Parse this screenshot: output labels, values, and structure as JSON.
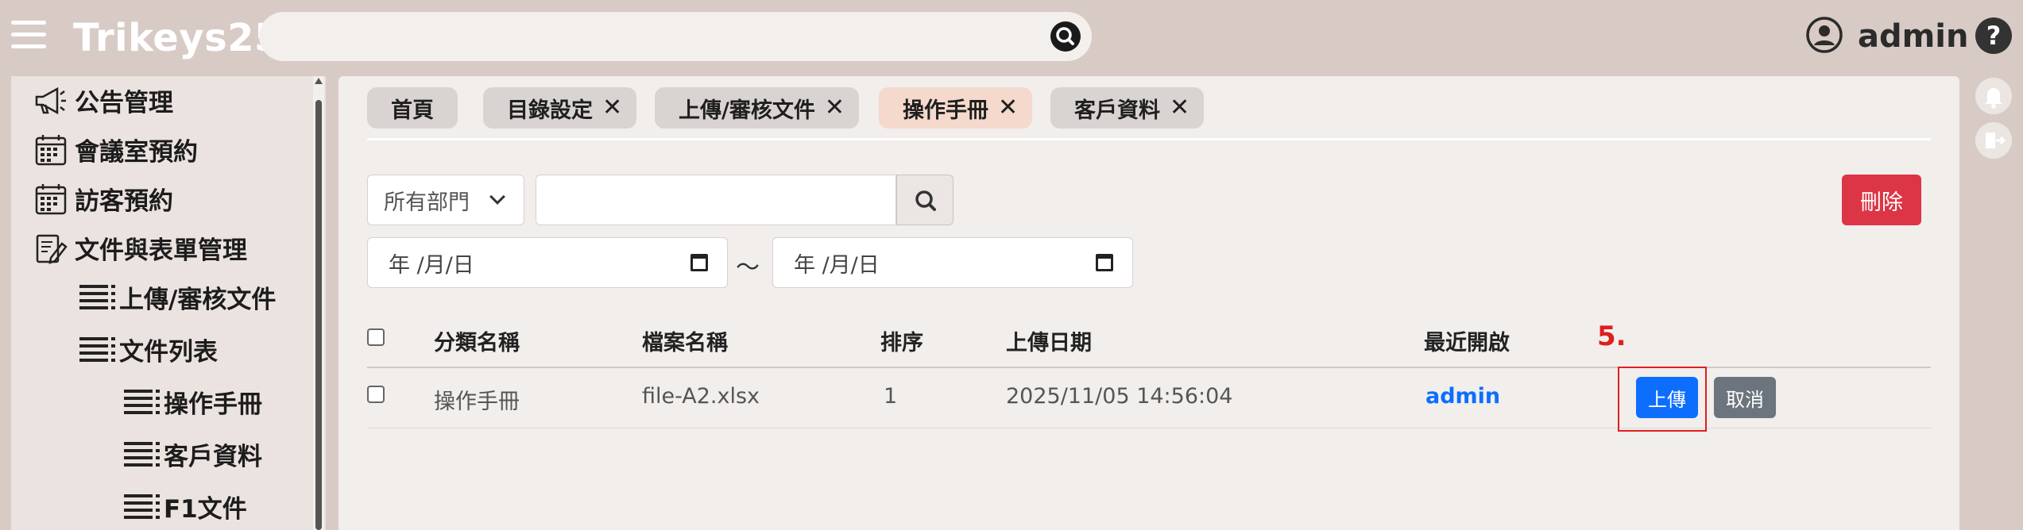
{
  "header": {
    "brand": "Trikeys25",
    "search_placeholder": "",
    "user_name": "admin",
    "help_glyph": "?"
  },
  "sidebar": {
    "items": [
      {
        "label": "公告管理",
        "icon": "megaphone-icon"
      },
      {
        "label": "會議室預約",
        "icon": "calendar-icon"
      },
      {
        "label": "訪客預約",
        "icon": "calendar-icon"
      },
      {
        "label": "文件與表單管理",
        "icon": "document-edit-icon"
      },
      {
        "label": "上傳/審核文件",
        "icon": "list-icon"
      },
      {
        "label": "文件列表",
        "icon": "list-icon"
      },
      {
        "label": "操作手冊",
        "icon": "list-icon"
      },
      {
        "label": "客戶資料",
        "icon": "list-icon"
      },
      {
        "label": "F1文件",
        "icon": "list-icon"
      }
    ]
  },
  "tabs": [
    {
      "label": "首頁",
      "closable": false,
      "active": false
    },
    {
      "label": "目錄設定",
      "closable": true,
      "active": false
    },
    {
      "label": "上傳/審核文件",
      "closable": true,
      "active": false
    },
    {
      "label": "操作手冊",
      "closable": true,
      "active": true
    },
    {
      "label": "客戶資料",
      "closable": true,
      "active": false
    }
  ],
  "tab_close_glyph": "✕",
  "filters": {
    "department": "所有部門",
    "keyword_value": "",
    "date_from": "年 /月/日",
    "date_to": "年 /月/日",
    "range_separator": "～",
    "delete_label": "刪除"
  },
  "table": {
    "columns": [
      "分類名稱",
      "檔案名稱",
      "排序",
      "上傳日期",
      "最近開啟"
    ],
    "rows": [
      {
        "category": "操作手冊",
        "filename": "file-A2.xlsx",
        "order": "1",
        "uploaded": "2025/11/05 14:56:04",
        "last_opened": "admin",
        "upload_label": "上傳",
        "cancel_label": "取消"
      }
    ]
  },
  "annotation": {
    "label": "5.",
    "color": "#e01e1e"
  },
  "colors": {
    "background": "#d8cbc6",
    "panel": "#f1eeec",
    "primary": "#0d6efd",
    "danger": "#dc3545",
    "secondary": "#6c757d",
    "active_tab": "#f4d9cc"
  }
}
